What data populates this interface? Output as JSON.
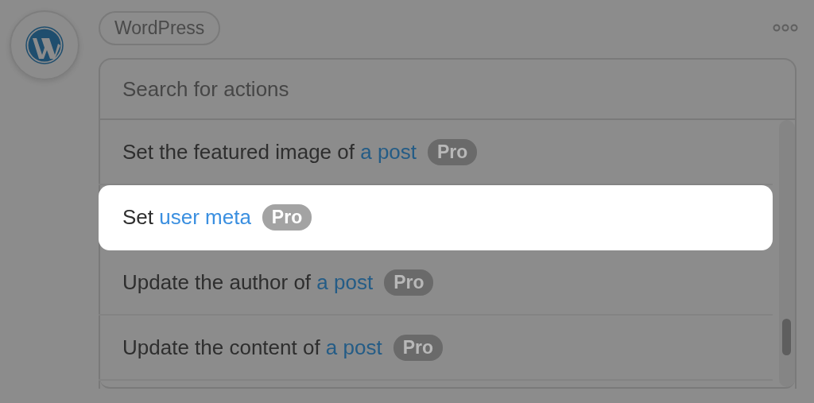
{
  "service": {
    "name": "WordPress"
  },
  "search": {
    "placeholder": "Search for actions"
  },
  "actions": [
    {
      "prefix": "Set the featured image of ",
      "link": "a post",
      "badge": "Pro",
      "selected": false
    },
    {
      "prefix": "Set ",
      "link": "user meta",
      "badge": "Pro",
      "selected": true
    },
    {
      "prefix": "Update the author of ",
      "link": "a post",
      "badge": "Pro",
      "selected": false
    },
    {
      "prefix": "Update the content of ",
      "link": "a post",
      "badge": "Pro",
      "selected": false
    }
  ]
}
